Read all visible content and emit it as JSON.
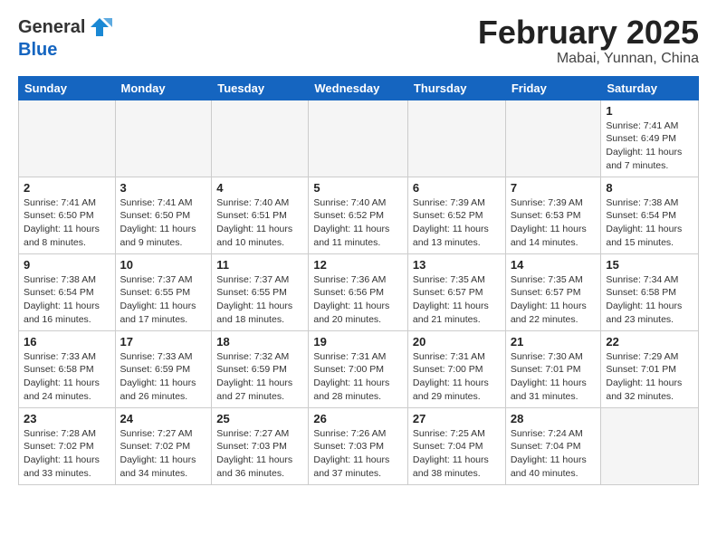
{
  "header": {
    "logo_general": "General",
    "logo_blue": "Blue",
    "title": "February 2025",
    "location": "Mabai, Yunnan, China"
  },
  "days_of_week": [
    "Sunday",
    "Monday",
    "Tuesday",
    "Wednesday",
    "Thursday",
    "Friday",
    "Saturday"
  ],
  "weeks": [
    [
      {
        "day": "",
        "info": ""
      },
      {
        "day": "",
        "info": ""
      },
      {
        "day": "",
        "info": ""
      },
      {
        "day": "",
        "info": ""
      },
      {
        "day": "",
        "info": ""
      },
      {
        "day": "",
        "info": ""
      },
      {
        "day": "1",
        "info": "Sunrise: 7:41 AM\nSunset: 6:49 PM\nDaylight: 11 hours\nand 7 minutes."
      }
    ],
    [
      {
        "day": "2",
        "info": "Sunrise: 7:41 AM\nSunset: 6:50 PM\nDaylight: 11 hours\nand 8 minutes."
      },
      {
        "day": "3",
        "info": "Sunrise: 7:41 AM\nSunset: 6:50 PM\nDaylight: 11 hours\nand 9 minutes."
      },
      {
        "day": "4",
        "info": "Sunrise: 7:40 AM\nSunset: 6:51 PM\nDaylight: 11 hours\nand 10 minutes."
      },
      {
        "day": "5",
        "info": "Sunrise: 7:40 AM\nSunset: 6:52 PM\nDaylight: 11 hours\nand 11 minutes."
      },
      {
        "day": "6",
        "info": "Sunrise: 7:39 AM\nSunset: 6:52 PM\nDaylight: 11 hours\nand 13 minutes."
      },
      {
        "day": "7",
        "info": "Sunrise: 7:39 AM\nSunset: 6:53 PM\nDaylight: 11 hours\nand 14 minutes."
      },
      {
        "day": "8",
        "info": "Sunrise: 7:38 AM\nSunset: 6:54 PM\nDaylight: 11 hours\nand 15 minutes."
      }
    ],
    [
      {
        "day": "9",
        "info": "Sunrise: 7:38 AM\nSunset: 6:54 PM\nDaylight: 11 hours\nand 16 minutes."
      },
      {
        "day": "10",
        "info": "Sunrise: 7:37 AM\nSunset: 6:55 PM\nDaylight: 11 hours\nand 17 minutes."
      },
      {
        "day": "11",
        "info": "Sunrise: 7:37 AM\nSunset: 6:55 PM\nDaylight: 11 hours\nand 18 minutes."
      },
      {
        "day": "12",
        "info": "Sunrise: 7:36 AM\nSunset: 6:56 PM\nDaylight: 11 hours\nand 20 minutes."
      },
      {
        "day": "13",
        "info": "Sunrise: 7:35 AM\nSunset: 6:57 PM\nDaylight: 11 hours\nand 21 minutes."
      },
      {
        "day": "14",
        "info": "Sunrise: 7:35 AM\nSunset: 6:57 PM\nDaylight: 11 hours\nand 22 minutes."
      },
      {
        "day": "15",
        "info": "Sunrise: 7:34 AM\nSunset: 6:58 PM\nDaylight: 11 hours\nand 23 minutes."
      }
    ],
    [
      {
        "day": "16",
        "info": "Sunrise: 7:33 AM\nSunset: 6:58 PM\nDaylight: 11 hours\nand 24 minutes."
      },
      {
        "day": "17",
        "info": "Sunrise: 7:33 AM\nSunset: 6:59 PM\nDaylight: 11 hours\nand 26 minutes."
      },
      {
        "day": "18",
        "info": "Sunrise: 7:32 AM\nSunset: 6:59 PM\nDaylight: 11 hours\nand 27 minutes."
      },
      {
        "day": "19",
        "info": "Sunrise: 7:31 AM\nSunset: 7:00 PM\nDaylight: 11 hours\nand 28 minutes."
      },
      {
        "day": "20",
        "info": "Sunrise: 7:31 AM\nSunset: 7:00 PM\nDaylight: 11 hours\nand 29 minutes."
      },
      {
        "day": "21",
        "info": "Sunrise: 7:30 AM\nSunset: 7:01 PM\nDaylight: 11 hours\nand 31 minutes."
      },
      {
        "day": "22",
        "info": "Sunrise: 7:29 AM\nSunset: 7:01 PM\nDaylight: 11 hours\nand 32 minutes."
      }
    ],
    [
      {
        "day": "23",
        "info": "Sunrise: 7:28 AM\nSunset: 7:02 PM\nDaylight: 11 hours\nand 33 minutes."
      },
      {
        "day": "24",
        "info": "Sunrise: 7:27 AM\nSunset: 7:02 PM\nDaylight: 11 hours\nand 34 minutes."
      },
      {
        "day": "25",
        "info": "Sunrise: 7:27 AM\nSunset: 7:03 PM\nDaylight: 11 hours\nand 36 minutes."
      },
      {
        "day": "26",
        "info": "Sunrise: 7:26 AM\nSunset: 7:03 PM\nDaylight: 11 hours\nand 37 minutes."
      },
      {
        "day": "27",
        "info": "Sunrise: 7:25 AM\nSunset: 7:04 PM\nDaylight: 11 hours\nand 38 minutes."
      },
      {
        "day": "28",
        "info": "Sunrise: 7:24 AM\nSunset: 7:04 PM\nDaylight: 11 hours\nand 40 minutes."
      },
      {
        "day": "",
        "info": ""
      }
    ]
  ]
}
